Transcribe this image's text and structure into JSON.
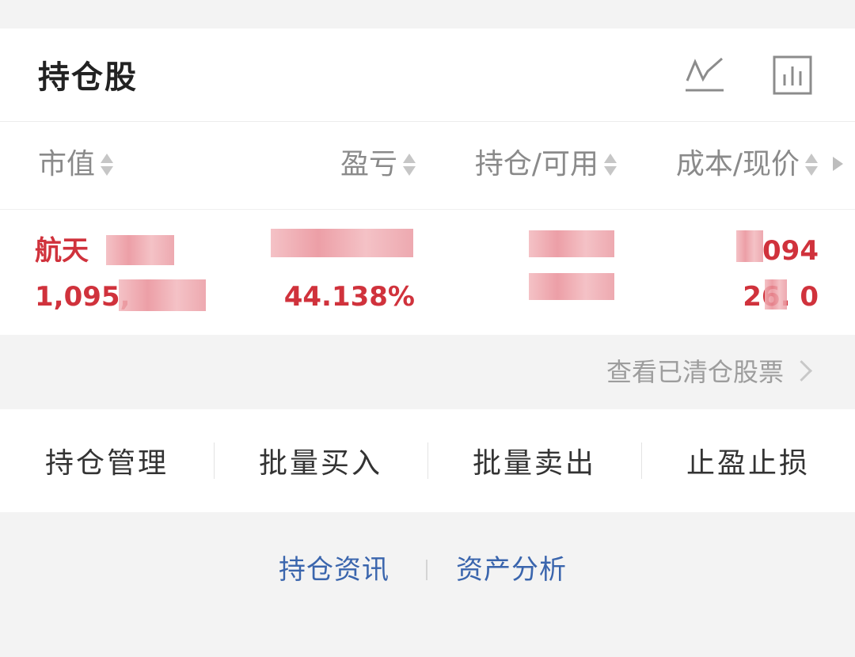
{
  "header": {
    "title": "持仓股",
    "icons": [
      "trend-line-icon",
      "bar-chart-icon"
    ]
  },
  "columns": {
    "market_value": "市值",
    "profit_loss": "盈亏",
    "position_available": "持仓/可用",
    "cost_price": "成本/现价"
  },
  "holding": {
    "name": "航天",
    "market_value": "1,095,",
    "profit_loss_pct": "44.138%",
    "cost": "094",
    "price": "26.  0",
    "color": "#d0323c"
  },
  "cleared_link": "查看已清仓股票",
  "actions": [
    "持仓管理",
    "批量买入",
    "批量卖出",
    "止盈止损"
  ],
  "links": {
    "news": "持仓资讯",
    "analysis": "资产分析",
    "color": "#3a65ad"
  }
}
